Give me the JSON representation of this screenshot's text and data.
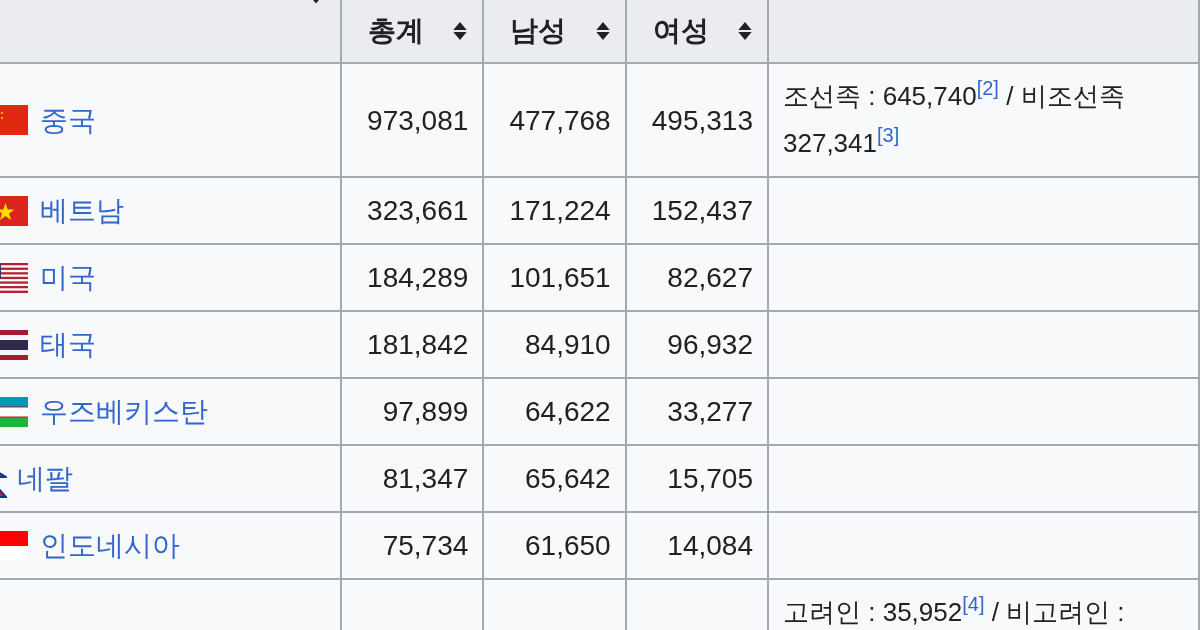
{
  "table": {
    "columns": [
      {
        "sortable": true,
        "kind": "country"
      },
      {
        "label": "총계",
        "sortable": true,
        "kind": "number"
      },
      {
        "label": "남성",
        "sortable": true,
        "kind": "number"
      },
      {
        "label": "여성",
        "sortable": true,
        "kind": "number"
      },
      {
        "kind": "note"
      }
    ],
    "rows": [
      {
        "country": "중국",
        "kind": "cn",
        "total": "973,081",
        "male": "477,768",
        "female": "495,313",
        "note": [
          {
            "kind": "text",
            "text": "조선족 : 645,740"
          },
          {
            "kind": "ref",
            "text": "[2]"
          },
          {
            "kind": "text",
            "text": " / 비조선족"
          },
          {
            "kind": "text",
            "text": "327,341"
          },
          {
            "kind": "ref",
            "text": "[3]"
          }
        ]
      },
      {
        "country": "베트남",
        "kind": "vn",
        "total": "323,661",
        "male": "171,224",
        "female": "152,437"
      },
      {
        "country": "미국",
        "kind": "us",
        "total": "184,289",
        "male": "101,651",
        "female": "82,627"
      },
      {
        "country": "태국",
        "kind": "th",
        "total": "181,842",
        "male": "84,910",
        "female": "96,932"
      },
      {
        "country": "우즈베키스탄",
        "kind": "uz",
        "total": "97,899",
        "male": "64,622",
        "female": "33,277"
      },
      {
        "country": "네팔",
        "kind": "np",
        "total": "81,347",
        "male": "65,642",
        "female": "15,705"
      },
      {
        "country": "인도네시아",
        "kind": "id",
        "total": "75,734",
        "male": "61,650",
        "female": "14,084"
      },
      {
        "note": [
          {
            "kind": "text",
            "text": "고려인 : 35,952"
          },
          {
            "kind": "ref",
            "text": "[4]"
          },
          {
            "kind": "text",
            "text": " / 비고려인 :"
          }
        ]
      }
    ]
  }
}
